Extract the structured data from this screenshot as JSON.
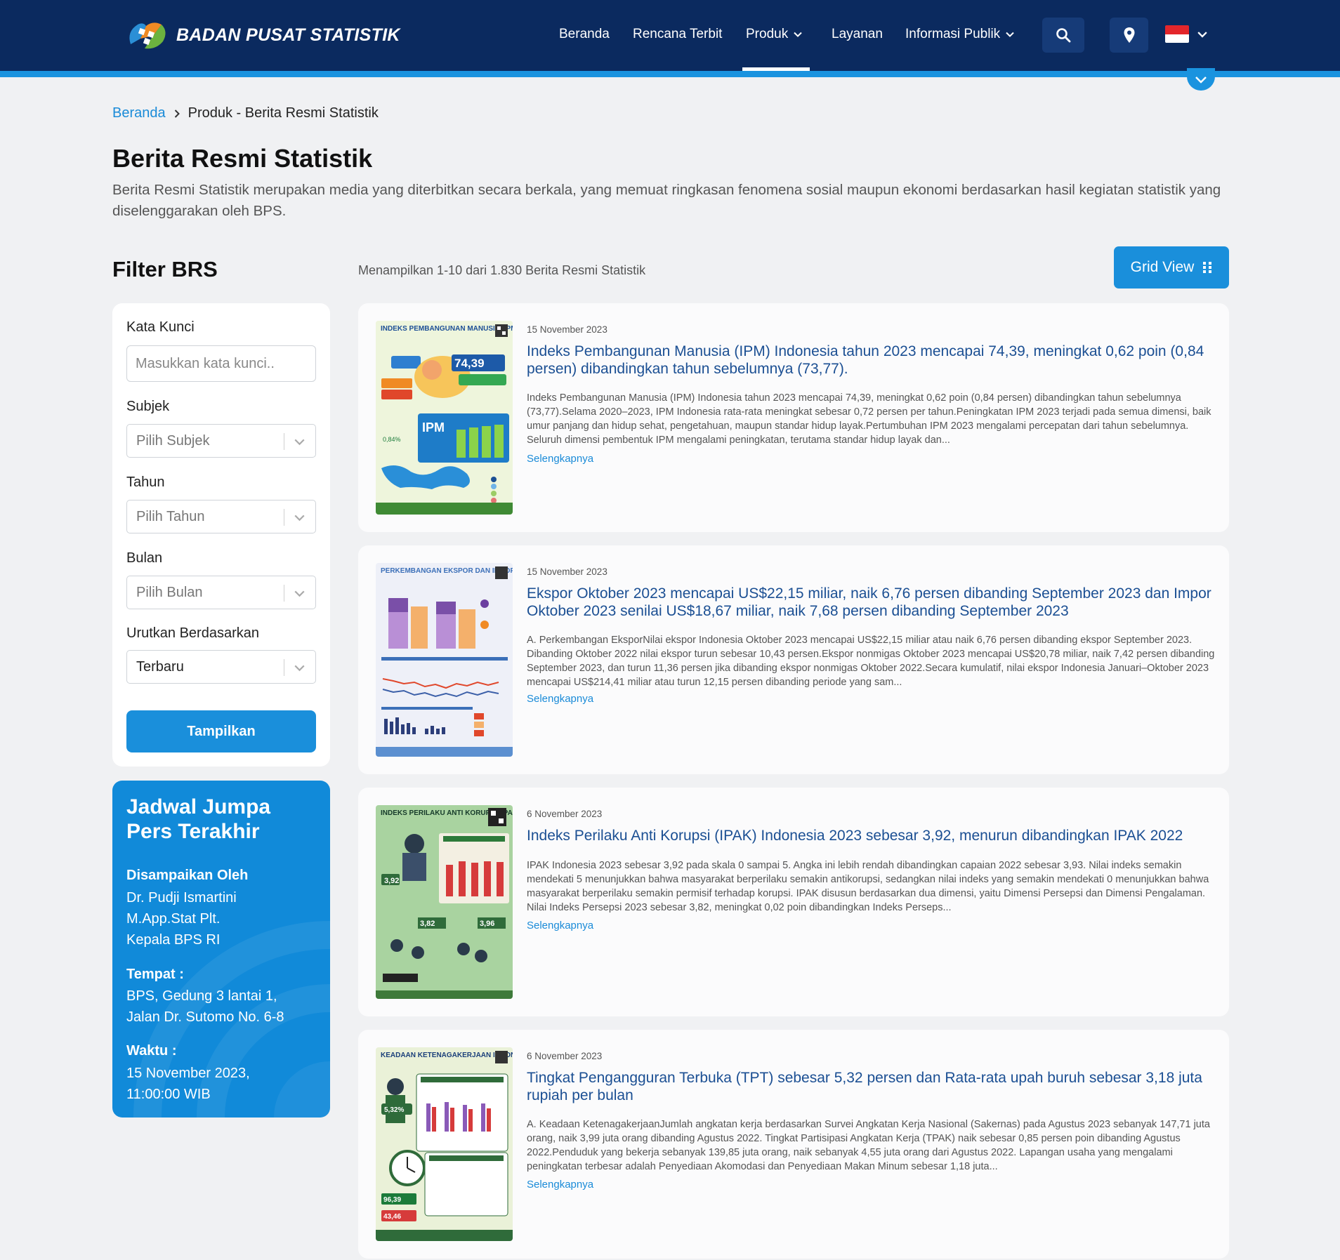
{
  "header": {
    "brand": "BADAN PUSAT STATISTIK",
    "nav": [
      {
        "label": "Beranda"
      },
      {
        "label": "Rencana Terbit"
      },
      {
        "label": "Produk"
      },
      {
        "label": "Layanan"
      },
      {
        "label": "Informasi Publik"
      }
    ],
    "active_nav": "Produk",
    "language_flag": "id-flag"
  },
  "breadcrumb": {
    "home": "Beranda",
    "current": "Produk - Berita Resmi Statistik"
  },
  "page": {
    "title": "Berita Resmi Statistik",
    "description": "Berita Resmi Statistik merupakan media yang diterbitkan secara berkala, yang memuat ringkasan fenomena sosial maupun ekonomi berdasarkan hasil kegiatan statistik yang diselenggarakan oleh BPS."
  },
  "filter": {
    "title": "Filter BRS",
    "keyword_label": "Kata Kunci",
    "keyword_placeholder": "Masukkan kata kunci..",
    "subject_label": "Subjek",
    "subject_value": "Pilih Subjek",
    "year_label": "Tahun",
    "year_value": "Pilih Tahun",
    "month_label": "Bulan",
    "month_value": "Pilih Bulan",
    "sort_label": "Urutkan Berdasarkan",
    "sort_value": "Terbaru",
    "submit": "Tampilkan"
  },
  "press": {
    "title": "Jadwal Jumpa Pers Terakhir",
    "by_label": "Disampaikan Oleh",
    "by_value": "Dr. Pudji Ismartini M.App.Stat Plt. Kepala BPS RI",
    "place_label": "Tempat :",
    "place_value": "BPS, Gedung 3 lantai 1, Jalan Dr. Sutomo No. 6-8",
    "time_label": "Waktu :",
    "time_value": "15 November 2023, 11:00:00 WIB"
  },
  "results": {
    "count_text": "Menampilkan 1-10 dari 1.830 Berita Resmi Statistik",
    "view_button": "Grid View",
    "more_label": "Selengkapnya",
    "items": [
      {
        "date": "15 November 2023",
        "title": "Indeks Pembangunan Manusia (IPM) Indonesia tahun 2023 mencapai 74,39, meningkat 0,62 poin (0,84 persen) dibandingkan tahun sebelumnya (73,77).",
        "summary": "Indeks Pembangunan Manusia (IPM) Indonesia tahun 2023 mencapai 74,39, meningkat 0,62 poin (0,84 persen) dibandingkan tahun sebelumnya (73,77).Selama 2020–2023, IPM Indonesia rata-rata meningkat sebesar 0,72 persen per tahun.Peningkatan IPM 2023 terjadi pada semua dimensi, baik umur panjang dan hidup sehat, pengetahuan, maupun standar hidup layak.Pertumbuhan IPM 2023 mengalami percepatan dari tahun sebelumnya. Seluruh dimensi pembentuk IPM mengalami peningkatan, terutama standar hidup layak dan...",
        "thumb": {
          "heading": "INDEKS PEMBANGUNAN MANUSIA (IPM) 2023",
          "figure": "74,39",
          "tag": "IPM",
          "note": "0,84%"
        }
      },
      {
        "date": "15 November 2023",
        "title": "Ekspor Oktober 2023 mencapai US$22,15 miliar, naik 6,76 persen dibanding September 2023 dan Impor Oktober 2023 senilai US$18,67 miliar, naik 7,68 persen dibanding September 2023",
        "summary": "A. Perkembangan EksporNilai ekspor Indonesia Oktober 2023 mencapai US$22,15 miliar atau naik 6,76 persen dibanding ekspor September 2023. Dibanding Oktober 2022 nilai ekspor turun sebesar 10,43 persen.Ekspor nonmigas Oktober 2023 mencapai US$20,78 miliar, naik 7,42 persen dibanding September 2023, dan turun 11,36 persen jika dibanding ekspor nonmigas Oktober 2022.Secara kumulatif, nilai ekspor Indonesia Januari–Oktober 2023 mencapai US$214,41 miliar atau turun 12,15 persen dibanding periode yang sam...",
        "thumb": {
          "heading": "PERKEMBANGAN EKSPOR DAN IMPOR INDONESIA OKTOBER 2023",
          "figure": "",
          "tag": "",
          "note": ""
        }
      },
      {
        "date": "6 November 2023",
        "title": "Indeks Perilaku Anti Korupsi (IPAK) Indonesia 2023 sebesar 3,92, menurun dibandingkan IPAK 2022",
        "summary": "IPAK Indonesia 2023 sebesar 3,92 pada skala 0 sampai 5. Angka ini lebih rendah dibandingkan capaian 2022 sebesar 3,93. Nilai indeks semakin mendekati 5 menunjukkan bahwa masyarakat berperilaku semakin antikorupsi, sedangkan nilai indeks yang semakin mendekati 0 menunjukkan bahwa masyarakat berperilaku semakin permisif terhadap korupsi. IPAK disusun berdasarkan dua dimensi, yaitu Dimensi Persepsi dan Dimensi Pengalaman. Nilai Indeks Persepsi 2023 sebesar 3,82, meningkat 0,02 poin dibandingkan Indeks Perseps...",
        "thumb": {
          "heading": "INDEKS PERILAKU ANTI KORUPSI (IPAK) 2023",
          "figure": "3,92",
          "tag": "3,82",
          "note": "3,96"
        }
      },
      {
        "date": "6 November 2023",
        "title": "Tingkat Pengangguran Terbuka (TPT) sebesar 5,32 persen dan Rata-rata upah buruh sebesar 3,18 juta rupiah per bulan",
        "summary": "A. Keadaan KetenagakerjaanJumlah angkatan kerja berdasarkan Survei Angkatan Kerja Nasional (Sakernas) pada Agustus 2023 sebanyak 147,71 juta orang, naik 3,99 juta orang dibanding Agustus 2022. Tingkat Partisipasi Angkatan Kerja (TPAK) naik sebesar 0,85 persen poin dibanding Agustus 2022.Penduduk yang bekerja sebanyak 139,85 juta orang, naik sebanyak 4,55 juta orang dari Agustus 2022. Lapangan usaha yang mengalami peningkatan terbesar adalah Penyediaan Akomodasi dan Penyediaan Makan Minum sebesar 1,18 juta...",
        "thumb": {
          "heading": "KEADAAN KETENAGAKERJAAN INDONESIA AGUSTUS 2023",
          "figure": "5,32%",
          "tag": "96,39",
          "note": "43,46"
        }
      }
    ]
  },
  "colors": {
    "header_bg": "#0b2a5f",
    "accent": "#1a93df",
    "title_link": "#1b4f93",
    "press_bg": "#118ad9"
  },
  "icons": [
    "bps-logo-icon",
    "chevron-down-icon",
    "search-icon",
    "location-pin-icon",
    "chevron-right-icon",
    "grid-icon",
    "qr-code-icon"
  ]
}
